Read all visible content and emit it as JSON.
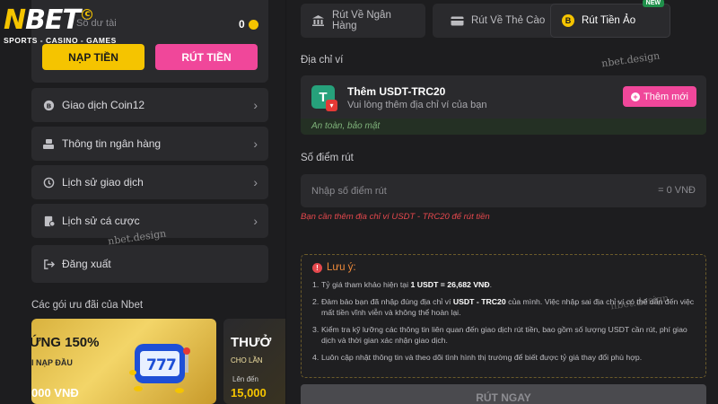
{
  "brand": {
    "name_n": "N",
    "name_rest": "BET",
    "copyright": "c",
    "tagline": "SPORTS - CASINO - GAMES"
  },
  "wallet": {
    "balance_label": "Số dư tài",
    "balance_value": "0",
    "deposit_label": "NẠP TIỀN",
    "withdraw_label": "RÚT TIỀN"
  },
  "menu": [
    {
      "label": "Giao dịch Coin12",
      "icon": "coin-icon"
    },
    {
      "label": "Thông tin ngân hàng",
      "icon": "bank-hand-icon"
    },
    {
      "label": "Lịch sử giao dịch",
      "icon": "history-icon"
    },
    {
      "label": "Lịch sử cá cược",
      "icon": "bet-history-icon"
    },
    {
      "label": "Đăng xuất",
      "icon": "logout-icon"
    }
  ],
  "promos": {
    "title": "Các gói ưu đãi của Nbet",
    "p1": {
      "headline": "ỨNG 150%",
      "sub": "I NẠP ĐẦU",
      "amount": "000 VNĐ"
    },
    "p2": {
      "headline": "THƯỞ",
      "sub": "CHO LẦN",
      "sub2": "Lên đến",
      "amount": "15,000"
    }
  },
  "tabs": [
    {
      "label": "Rút Về Ngân Hàng",
      "icon": "bank-icon"
    },
    {
      "label": "Rút Về Thẻ Cào",
      "icon": "card-icon"
    },
    {
      "label": "Rút Tiền Ảo",
      "icon": "bitcoin-icon",
      "badge": "NEW",
      "active": true
    }
  ],
  "form": {
    "wallet_label": "Địa chỉ ví",
    "wallet_title": "Thêm USDT-TRC20",
    "wallet_desc": "Vui lòng thêm địa chỉ ví của bạn",
    "wallet_safe": "An toàn, bảo mật",
    "add_label": "Thêm mới",
    "amount_label": "Số điểm rút",
    "amount_placeholder": "Nhập số điểm rút",
    "amount_conversion": "= 0 VNĐ",
    "warning": "Bạn cần thêm địa chỉ ví USDT - TRC20 để rút tiền",
    "submit_label": "RÚT NGAY"
  },
  "notice": {
    "title": "Lưu ý:",
    "items": [
      {
        "num": "1.",
        "pre": "Tỷ giá tham khảo hiện tại ",
        "bold": "1 USDT = 26,682 VNĐ",
        "post": "."
      },
      {
        "num": "2.",
        "pre": "Đảm bảo bạn đã nhập đúng địa chỉ ví ",
        "bold": "USDT - TRC20",
        "post": " của mình. Việc nhập sai địa chỉ ví có thể dẫn đến việc mất tiền vĩnh viễn và không thể hoàn lại."
      },
      {
        "num": "3.",
        "pre": "Kiểm tra kỹ lưỡng các thông tin liên quan đến giao dịch rút tiền, bao gồm số lượng USDT cần rút, phí giao dịch và thời gian xác nhận giao dịch.",
        "bold": "",
        "post": ""
      },
      {
        "num": "4.",
        "pre": "Luôn cập nhật thông tin và theo dõi tình hình thị trường để biết được tỷ giá thay đổi phù hợp.",
        "bold": "",
        "post": ""
      }
    ]
  },
  "watermarks": [
    "nbet.design",
    "nbet.design",
    "nbet.design"
  ],
  "colors": {
    "accent_yellow": "#f5c400",
    "accent_pink": "#f0479a",
    "usdt_green": "#26a17b",
    "warning_red": "#e5484d"
  }
}
